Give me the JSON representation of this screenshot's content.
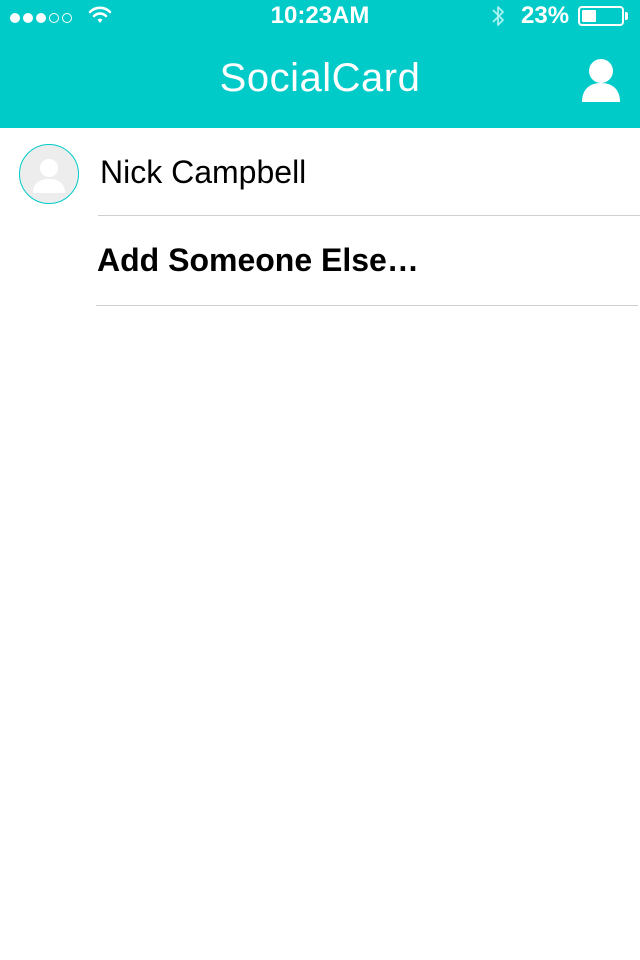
{
  "status_bar": {
    "signal_total": 5,
    "signal_filled": 3,
    "time": "10:23AM",
    "battery_percent_label": "23%",
    "battery_level": 0.23,
    "icons": {
      "wifi": "wifi-icon",
      "bluetooth": "bluetooth-icon",
      "battery": "battery-icon"
    }
  },
  "nav_bar": {
    "title": "SocialCard",
    "right_icon": "user-profile-icon"
  },
  "contacts": [
    {
      "name": "Nick Campbell",
      "avatar_icon": "default-avatar-icon"
    }
  ],
  "add_action": {
    "label": "Add Someone Else…"
  },
  "colors": {
    "accent": "#00cbc8",
    "text": "#000000",
    "divider": "#cfcfcf",
    "avatar_bg": "#ededed"
  }
}
